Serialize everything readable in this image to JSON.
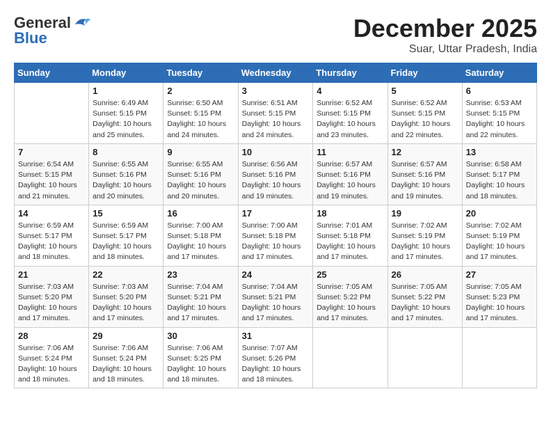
{
  "header": {
    "logo_line1": "General",
    "logo_line2": "Blue",
    "month": "December 2025",
    "location": "Suar, Uttar Pradesh, India"
  },
  "weekdays": [
    "Sunday",
    "Monday",
    "Tuesday",
    "Wednesday",
    "Thursday",
    "Friday",
    "Saturday"
  ],
  "weeks": [
    [
      {
        "day": "",
        "sunrise": "",
        "sunset": "",
        "daylight": ""
      },
      {
        "day": "1",
        "sunrise": "6:49 AM",
        "sunset": "5:15 PM",
        "daylight": "10 hours and 25 minutes."
      },
      {
        "day": "2",
        "sunrise": "6:50 AM",
        "sunset": "5:15 PM",
        "daylight": "10 hours and 24 minutes."
      },
      {
        "day": "3",
        "sunrise": "6:51 AM",
        "sunset": "5:15 PM",
        "daylight": "10 hours and 24 minutes."
      },
      {
        "day": "4",
        "sunrise": "6:52 AM",
        "sunset": "5:15 PM",
        "daylight": "10 hours and 23 minutes."
      },
      {
        "day": "5",
        "sunrise": "6:52 AM",
        "sunset": "5:15 PM",
        "daylight": "10 hours and 22 minutes."
      },
      {
        "day": "6",
        "sunrise": "6:53 AM",
        "sunset": "5:15 PM",
        "daylight": "10 hours and 22 minutes."
      }
    ],
    [
      {
        "day": "7",
        "sunrise": "6:54 AM",
        "sunset": "5:15 PM",
        "daylight": "10 hours and 21 minutes."
      },
      {
        "day": "8",
        "sunrise": "6:55 AM",
        "sunset": "5:16 PM",
        "daylight": "10 hours and 20 minutes."
      },
      {
        "day": "9",
        "sunrise": "6:55 AM",
        "sunset": "5:16 PM",
        "daylight": "10 hours and 20 minutes."
      },
      {
        "day": "10",
        "sunrise": "6:56 AM",
        "sunset": "5:16 PM",
        "daylight": "10 hours and 19 minutes."
      },
      {
        "day": "11",
        "sunrise": "6:57 AM",
        "sunset": "5:16 PM",
        "daylight": "10 hours and 19 minutes."
      },
      {
        "day": "12",
        "sunrise": "6:57 AM",
        "sunset": "5:16 PM",
        "daylight": "10 hours and 19 minutes."
      },
      {
        "day": "13",
        "sunrise": "6:58 AM",
        "sunset": "5:17 PM",
        "daylight": "10 hours and 18 minutes."
      }
    ],
    [
      {
        "day": "14",
        "sunrise": "6:59 AM",
        "sunset": "5:17 PM",
        "daylight": "10 hours and 18 minutes."
      },
      {
        "day": "15",
        "sunrise": "6:59 AM",
        "sunset": "5:17 PM",
        "daylight": "10 hours and 18 minutes."
      },
      {
        "day": "16",
        "sunrise": "7:00 AM",
        "sunset": "5:18 PM",
        "daylight": "10 hours and 17 minutes."
      },
      {
        "day": "17",
        "sunrise": "7:00 AM",
        "sunset": "5:18 PM",
        "daylight": "10 hours and 17 minutes."
      },
      {
        "day": "18",
        "sunrise": "7:01 AM",
        "sunset": "5:18 PM",
        "daylight": "10 hours and 17 minutes."
      },
      {
        "day": "19",
        "sunrise": "7:02 AM",
        "sunset": "5:19 PM",
        "daylight": "10 hours and 17 minutes."
      },
      {
        "day": "20",
        "sunrise": "7:02 AM",
        "sunset": "5:19 PM",
        "daylight": "10 hours and 17 minutes."
      }
    ],
    [
      {
        "day": "21",
        "sunrise": "7:03 AM",
        "sunset": "5:20 PM",
        "daylight": "10 hours and 17 minutes."
      },
      {
        "day": "22",
        "sunrise": "7:03 AM",
        "sunset": "5:20 PM",
        "daylight": "10 hours and 17 minutes."
      },
      {
        "day": "23",
        "sunrise": "7:04 AM",
        "sunset": "5:21 PM",
        "daylight": "10 hours and 17 minutes."
      },
      {
        "day": "24",
        "sunrise": "7:04 AM",
        "sunset": "5:21 PM",
        "daylight": "10 hours and 17 minutes."
      },
      {
        "day": "25",
        "sunrise": "7:05 AM",
        "sunset": "5:22 PM",
        "daylight": "10 hours and 17 minutes."
      },
      {
        "day": "26",
        "sunrise": "7:05 AM",
        "sunset": "5:22 PM",
        "daylight": "10 hours and 17 minutes."
      },
      {
        "day": "27",
        "sunrise": "7:05 AM",
        "sunset": "5:23 PM",
        "daylight": "10 hours and 17 minutes."
      }
    ],
    [
      {
        "day": "28",
        "sunrise": "7:06 AM",
        "sunset": "5:24 PM",
        "daylight": "10 hours and 18 minutes."
      },
      {
        "day": "29",
        "sunrise": "7:06 AM",
        "sunset": "5:24 PM",
        "daylight": "10 hours and 18 minutes."
      },
      {
        "day": "30",
        "sunrise": "7:06 AM",
        "sunset": "5:25 PM",
        "daylight": "10 hours and 18 minutes."
      },
      {
        "day": "31",
        "sunrise": "7:07 AM",
        "sunset": "5:26 PM",
        "daylight": "10 hours and 18 minutes."
      },
      {
        "day": "",
        "sunrise": "",
        "sunset": "",
        "daylight": ""
      },
      {
        "day": "",
        "sunrise": "",
        "sunset": "",
        "daylight": ""
      },
      {
        "day": "",
        "sunrise": "",
        "sunset": "",
        "daylight": ""
      }
    ]
  ]
}
